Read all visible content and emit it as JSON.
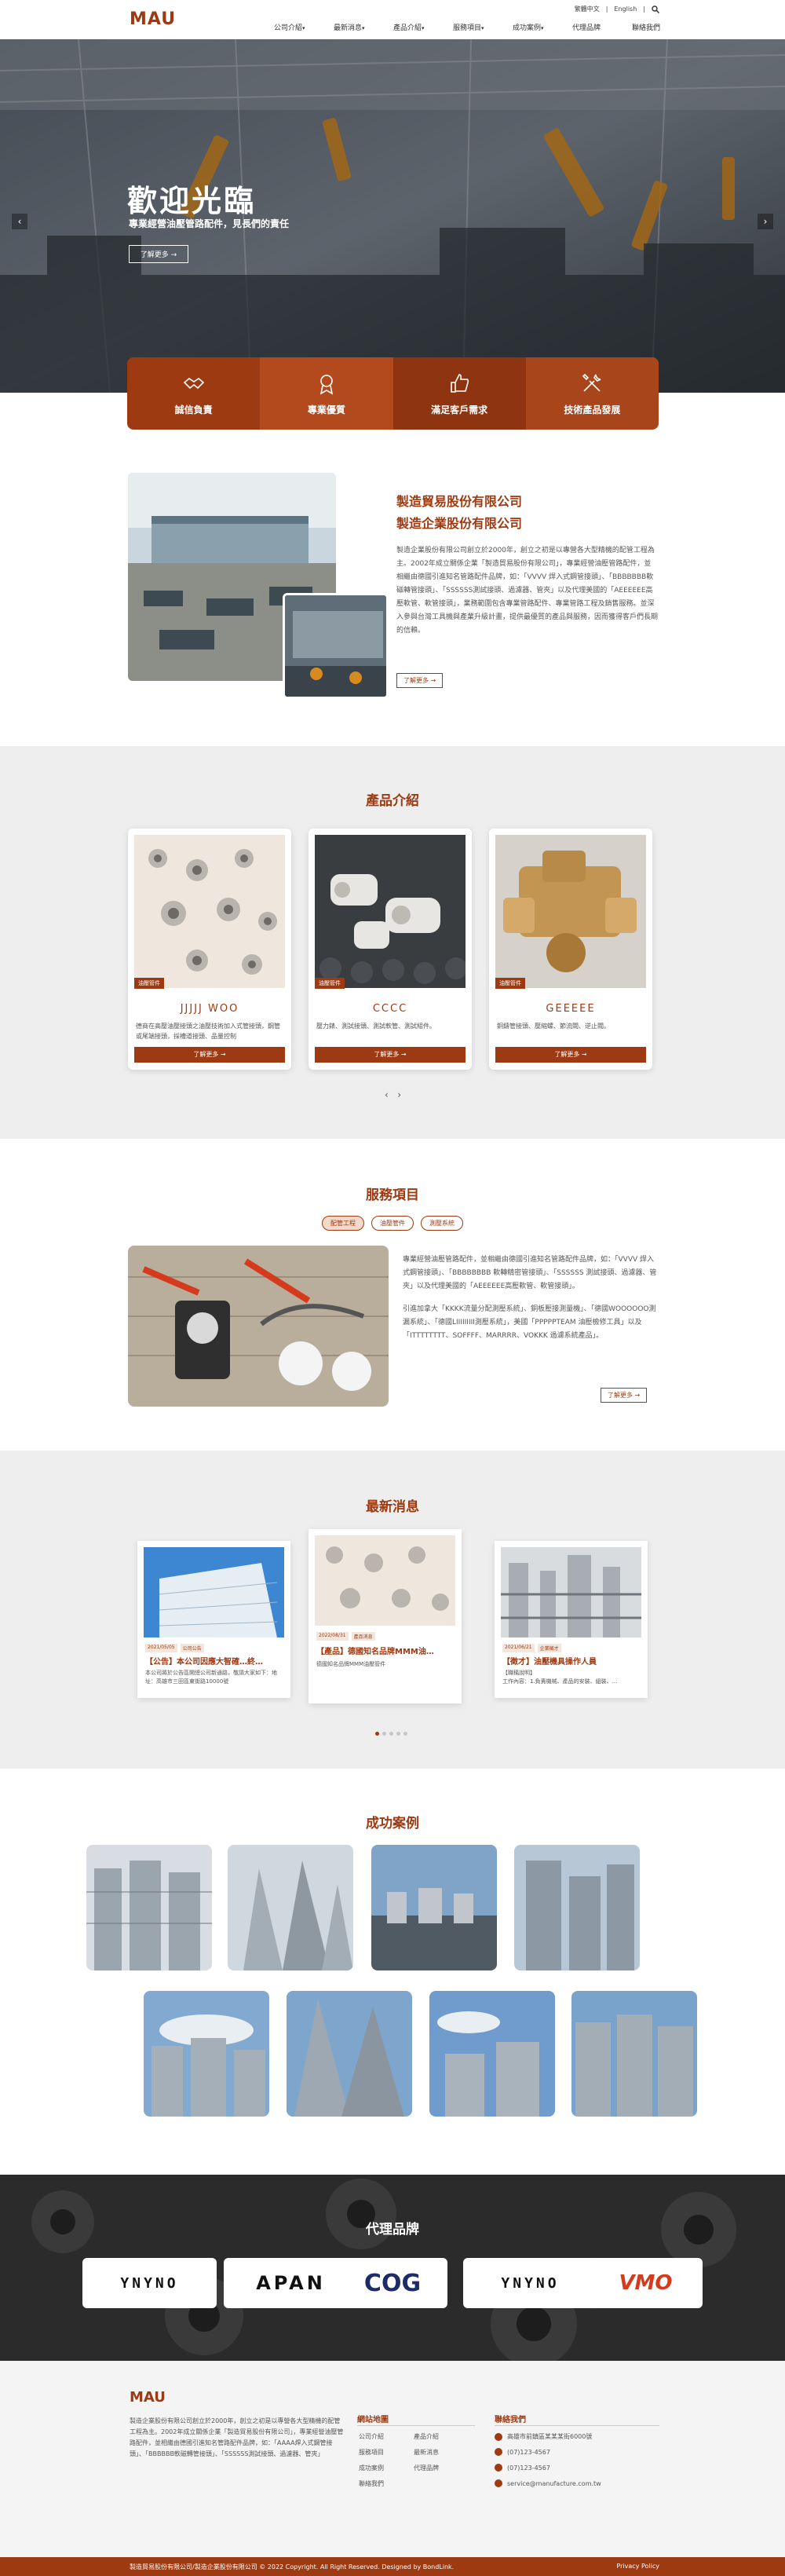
{
  "header": {
    "logo": "MAU",
    "lang_tc": "繁體中文",
    "lang_en": "English",
    "nav": [
      {
        "label": "公司介紹",
        "dropdown": true
      },
      {
        "label": "最新消息",
        "dropdown": true
      },
      {
        "label": "產品介紹",
        "dropdown": true
      },
      {
        "label": "服務項目",
        "dropdown": true
      },
      {
        "label": "成功案例",
        "dropdown": true
      },
      {
        "label": "代理品牌",
        "dropdown": false
      },
      {
        "label": "聯絡我們",
        "dropdown": false
      }
    ]
  },
  "hero": {
    "title": "歡迎光臨",
    "subtitle": "專業經營油壓管路配件，見長們的責任",
    "button": "了解更多 →"
  },
  "features": [
    {
      "label": "誠信負責",
      "icon": "handshake-icon"
    },
    {
      "label": "專業優質",
      "icon": "medal-icon"
    },
    {
      "label": "滿足客戶需求",
      "icon": "thumbs-up-icon"
    },
    {
      "label": "技術產品發展",
      "icon": "tools-icon"
    }
  ],
  "about": {
    "title1": "製造貿易股份有限公司",
    "title2": "製造企業股份有限公司",
    "text": "製造企業股份有限公司創立於2000年，創立之初是以專營各大型精機的配管工程為主。2002年成立關係企業「製造貿易股份有限公司」，專業經營油壓管路配件，並相繼由德國引進知名管路配件品牌，如：「VVVV 焊入式鋼管接頭」、「BBBBBBB軟磁轉管接頭」、「SSSSSS測試接頭、過濾器、管夾」以及代理美國的「AEEEEEE高壓軟管、軟管接頭」，業務範圍包含專業管路配件、專業管路工程及銷售服務。並深入參與台灣工具機與產業升級計畫，提供最優質的產品與服務，因而獲得客戶們長期的信賴。",
    "button": "了解更多 →"
  },
  "products": {
    "title": "產品介紹",
    "items": [
      {
        "tag": "油壓管件",
        "name": "JJJJJ WOO",
        "desc": "德商在高壓油壓接頭之油壓技術加入式管接頭，鋼管或尾端接頭，採槽道接頭、品量控制",
        "button": "了解更多 →"
      },
      {
        "tag": "油壓管件",
        "name": "CCCC",
        "desc": "壓力錶、測試接頭、測試軟管、測試組件。",
        "button": "了解更多 →"
      },
      {
        "tag": "油壓管件",
        "name": "GEEEEE",
        "desc": "銅鑄管接頭、壓縮螺、節流閥、逆止閥。",
        "button": "了解更多 →"
      }
    ],
    "nav_prev": "‹",
    "nav_next": "›"
  },
  "services": {
    "title": "服務項目",
    "tabs": [
      "配管工程",
      "油壓管件",
      "測壓系統"
    ],
    "p1": "專業經營油壓管路配件，並相繼由德國引進知名管路配件品牌，如：「VVVV 焊入式鋼管接頭」、「BBBBBBBB 軟轉精密管接頭」、「SSSSSS 測試接頭、過濾器、管夾」以及代理美國的「AEEEEEE高壓軟管、軟管接頭」。",
    "p2": "引進加拿大「KKKK流量分配測壓系統」、銅板壓接測量機」、「德國WOOOOOO測漏系統」、「德國LIIIIIIIII測壓系統」，美國「PPPPPTEAM 油壓檢修工具」以及「ITTTTTTTT、SOFFFF、MARRRR、VOKKK 過濾系統產品」。",
    "button": "了解更多 →"
  },
  "news": {
    "title": "最新消息",
    "items": [
      {
        "date": "2021/05/05",
        "cat": "公司公告",
        "title": "【公告】本公司因應大智確…終…",
        "desc": "本公司將於公告區開總公司新通路，敬請大家如下：地址：高雄市三田區東街路10000號"
      },
      {
        "date": "2022/08/31",
        "cat": "產品消息",
        "title": "【產品】德國知名品牌MMM油…",
        "desc": "德國知名品牌MMM油壓管件"
      },
      {
        "date": "2021/06/21",
        "cat": "企業徵才",
        "title": "【徵才】油壓機具操作人員",
        "desc": "【職稱說明】\n工作內容：1.負責機械、產品的安裝、組裝、…"
      }
    ],
    "dots": 5,
    "active_dot": 0
  },
  "cases": {
    "title": "成功案例"
  },
  "agents": {
    "title": "代理品牌",
    "brands": [
      "YNYNO",
      "APAN",
      "COG",
      "YNYNO",
      "VMO"
    ]
  },
  "footer": {
    "logo": "MAU",
    "text": "製造企業股份有限公司創立於2000年，創立之初是以專營各大型精機的配管工程為主。2002年成立關係企業「製造貿易股份有限公司」，專業經營油壓管路配件，並相繼由德國引進知名管路配件品牌，如：「AAAA焊入式鋼管接頭」、「BBBBBB軟磁轉管接頭」、「SSSSSS測試接頭、過濾器、管夾」",
    "sitemap_title": "網站地圖",
    "links": [
      "公司介紹",
      "產品介紹",
      "服務項目",
      "最新消息",
      "成功案例",
      "代理品牌",
      "聯絡我們"
    ],
    "contact_title": "聯絡我們",
    "address": "高雄市前鎮區某某某街6000號",
    "tel": "(07)123-4567",
    "fax": "(07)123-4567",
    "email": "service@manufacture.com.tw",
    "copyright": "製造貿易股份有限公司/製造企業股份有限公司 © 2022 Copyright. All Right Reserved. Designed by BondLink.",
    "privacy": "Privacy Policy"
  }
}
